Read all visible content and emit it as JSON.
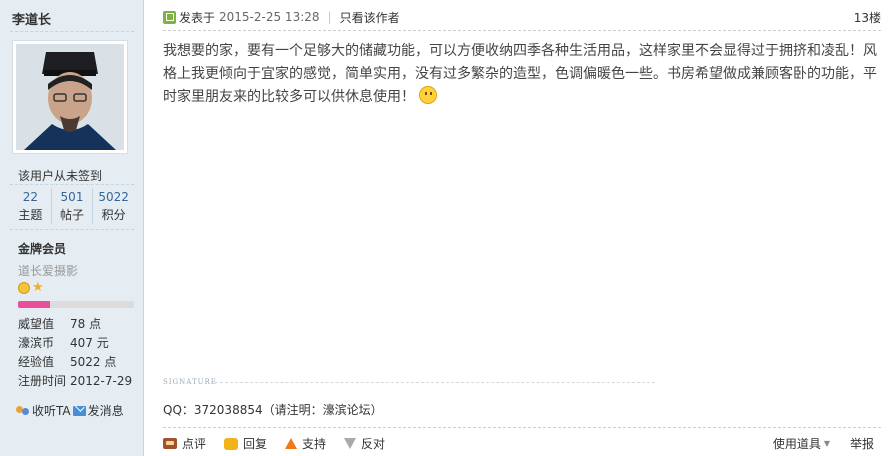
{
  "author": {
    "name": "李道长",
    "checkin": "该用户从未签到",
    "stats": [
      {
        "value": "22",
        "label": "主题"
      },
      {
        "value": "501",
        "label": "帖子"
      },
      {
        "value": "5022",
        "label": "积分"
      }
    ],
    "rank": "金牌会员",
    "custom_title": "道长爱摄影",
    "level_progress": 0.28,
    "level_color": "#e8509b",
    "info": [
      {
        "k": "威望值",
        "v": "78 点"
      },
      {
        "k": "濠滨币",
        "v": "407 元"
      },
      {
        "k": "经验值",
        "v": "5022 点"
      },
      {
        "k": "注册时间",
        "v": "2012-7-29"
      }
    ],
    "actions": {
      "listen": "收听TA",
      "message": "发消息"
    }
  },
  "post": {
    "posted_label": "发表于",
    "datetime": "2015-2-25 13:28",
    "only_author": "只看该作者",
    "floor": "13楼",
    "content": "我想要的家，要有一个足够大的储藏功能，可以方便收纳四季各种生活用品，这样家里不会显得过于拥挤和凌乱！风格上我更倾向于宜家的感觉，简单实用，没有过多繁杂的造型，色调偏暖色一些。书房希望做成兼顾客卧的功能，平时家里朋友来的比较多可以供休息使用！",
    "signature_tag": "SIGNATURE",
    "signature": "QQ：372038854（请注明：濠滨论坛）"
  },
  "footer": {
    "rate": "点评",
    "reply": "回复",
    "support": "支持",
    "oppose": "反对",
    "tools": "使用道具",
    "report": "举报"
  }
}
